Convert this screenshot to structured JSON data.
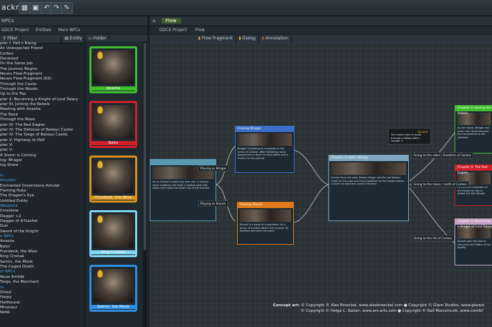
{
  "app": {
    "logo": "ackraft"
  },
  "left": {
    "tab": "NPCs",
    "breadcrumb": [
      "GDCE Project",
      "Entities",
      "Main NPCs"
    ],
    "filter_label": "Filter",
    "entity_label": "Entity",
    "folder_label": "Folder",
    "tree": [
      {
        "t": "pter I: Hell's Rising",
        "c": false
      },
      {
        "t": "An Unexpected Friend",
        "c": false
      },
      {
        "t": "Corbec",
        "c": false
      },
      {
        "t": "Deceived",
        "c": false
      },
      {
        "t": "On the Same Job",
        "c": false
      },
      {
        "t": "The Journey Begins",
        "c": false
      },
      {
        "t": "Neues Flow-Fragment",
        "c": false
      },
      {
        "t": "Neues Flow-Fragment (03)",
        "c": false
      },
      {
        "t": "Through the Caves",
        "c": false
      },
      {
        "t": "Through the Woods",
        "c": false
      },
      {
        "t": "Up to the Top",
        "c": false
      },
      {
        "t": "pter II: Becoming a Knight of Lord Talary",
        "c": false
      },
      {
        "t": "pter III: Joining the Rebels",
        "c": false
      },
      {
        "t": "Meeting with Anasha",
        "c": false
      },
      {
        "t": "The Race",
        "c": false
      },
      {
        "t": "Through the Maze",
        "c": false
      },
      {
        "t": "pter IV: The Red Eagles",
        "c": false
      },
      {
        "t": "pter IV: The Defense of Belwyc Castle",
        "c": false
      },
      {
        "t": "pter IV: The Siege of Belwyc Castle",
        "c": false
      },
      {
        "t": "pter V: Highway to Hell",
        "c": false
      },
      {
        "t": "pter V:",
        "c": false
      },
      {
        "t": "pter V:",
        "c": false
      },
      {
        "t": "A Storm is Coming",
        "c": false
      },
      {
        "t": "log: Bhagar",
        "c": false
      },
      {
        "t": "log Share",
        "c": false
      },
      {
        "t": "",
        "c": false
      },
      {
        "t": "ts",
        "c": true
      },
      {
        "t": "Amulets",
        "c": true
      },
      {
        "t": "Enchanted Greenstone Amulet",
        "c": false
      },
      {
        "t": "Flaming Ruby",
        "c": false
      },
      {
        "t": "The Dragon's Eye",
        "c": false
      },
      {
        "t": "Untitled Entity",
        "c": false
      },
      {
        "t": "Weapons",
        "c": true
      },
      {
        "t": "Crossbow",
        "c": false
      },
      {
        "t": "Dagger +2",
        "c": false
      },
      {
        "t": "Dagger of A'Gashai",
        "c": false
      },
      {
        "t": "Gun",
        "c": false
      },
      {
        "t": "Sword of the Knight",
        "c": false
      },
      {
        "t": "n NPCs",
        "c": true
      },
      {
        "t": "Anasha",
        "c": false
      },
      {
        "t": "Balor",
        "c": false
      },
      {
        "t": "Frandenk, the Wise",
        "c": false
      },
      {
        "t": "King Cirshak",
        "c": false
      },
      {
        "t": "Selmir, the Monk",
        "c": false
      },
      {
        "t": "The Caged Death",
        "c": false
      },
      {
        "t": "or NPCs",
        "c": true
      },
      {
        "t": "Neue Entität",
        "c": false
      },
      {
        "t": "Torgo, the Merchant",
        "c": false
      },
      {
        "t": "rs",
        "c": true
      },
      {
        "t": "Ghoul",
        "c": false
      },
      {
        "t": "Harpy",
        "c": false
      },
      {
        "t": "Hellhound",
        "c": false
      },
      {
        "t": "Minotaur",
        "c": false
      },
      {
        "t": "Nebk",
        "c": false
      }
    ],
    "cards": [
      {
        "name": "Anasha",
        "color": "#3fbf2e"
      },
      {
        "name": "Balor",
        "color": "#d0202a"
      },
      {
        "name": "Frandenk, the Wise",
        "color": "#d9921a"
      },
      {
        "name": "King Cirshak",
        "color": "#7fd6f0"
      },
      {
        "name": "Selmir, the Monk",
        "color": "#2f8fe0"
      }
    ]
  },
  "right": {
    "tab": "Flow",
    "breadcrumb": [
      "GDCE Project",
      "Flow"
    ],
    "tools": [
      "Flow Fragment",
      "Dialog",
      "Annotation"
    ],
    "nodes": [
      {
        "title": "",
        "color": "#5a9ab0",
        "body": "Ian is hunted in watching over you, a serious smile suddenly the head a shaded robe that walks and inside the tower top of the fortress."
      },
      {
        "title": "Freeing Bhagar",
        "color": "#3b6fc9",
        "body": "Bhagar is fighting as champion in the arena of Carless. After defeating many opponents he buys his final battle and is thrown to the ground."
      },
      {
        "title": "Freeing Shanik",
        "color": "#e07a1a",
        "body": "Shanik is a slave of a wanderer. As a group of bandits attack the caravan he escapes and joins the party."
      },
      {
        "title": "Chapter II: Hell's Rising",
        "color": "#7fa8c0",
        "body": "Anshar from the west Dassar Magar and the old Wizard meet on the road and travel together to the capital before a storm of darkness covers the land."
      },
      {
        "title": "Chapter II: Joining the Rebels",
        "color": "#3fbf2e",
        "body": "As the rebels, Bhagar and Ahari and Carles discover the connections to the rebellion."
      },
      {
        "title": "Chapter II: The Red Eagles",
        "color": "#d0202a",
        "body": "To become a member of the Eagles he has to defeat the Red Knight."
      },
      {
        "title": "Chapter II: Becoming a Knight of Lord Talary",
        "color": "#c7a1c4",
        "body": "Shanik gets the task to convince Lord Talary of his loyalty."
      }
    ],
    "pins": [
      {
        "text": "Playing as Bhagar"
      },
      {
        "text": "Playing as Shanik"
      },
      {
        "text": "Going to the rebel / Outskirts of Carless"
      },
      {
        "text": "Going to the moon / north of Carless"
      },
      {
        "text": "Going to the hill of Carless"
      }
    ],
    "annotation": {
      "title": "WIZARD",
      "text": "The choice here is made through a dialog within chapter 1"
    }
  },
  "footer": {
    "label": "Concept art:",
    "lines": [
      "© Copyright © Alex Broeckel, www.alexbroeckel.com ● Copyright © Glare Studios, www.glarest",
      "© Copyright © Helge C. Balzer, www.ars-arts.com ● Copyright © Ralf Marczinczik, www.comikf"
    ]
  }
}
